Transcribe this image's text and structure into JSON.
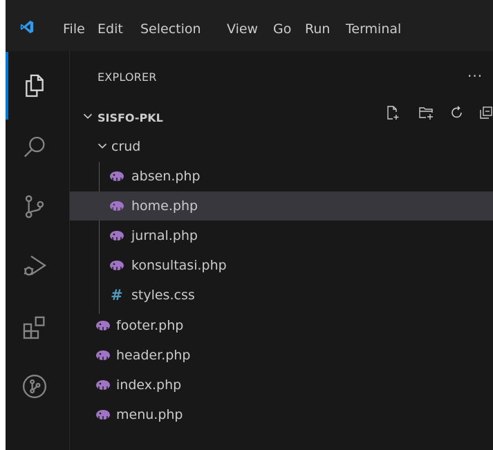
{
  "menu": {
    "items": [
      "File",
      "Edit",
      "Selection",
      "View",
      "Go",
      "Run",
      "Terminal"
    ]
  },
  "sidebar": {
    "title": "EXPLORER",
    "more": "···",
    "project": "SISFO-PKL",
    "folder": "crud",
    "folder_files": [
      "absen.php",
      "home.php",
      "jurnal.php",
      "konsultasi.php",
      "styles.css"
    ],
    "root_files": [
      "footer.php",
      "header.php",
      "index.php",
      "menu.php"
    ],
    "selected_file": "home.php"
  },
  "colors": {
    "accent": "#0078d4",
    "php_icon": "#a074c4",
    "css_icon": "#519aba",
    "selected_row": "#37373d"
  },
  "icons": {
    "activity_bar": [
      "files-icon",
      "search-icon",
      "source-control-icon",
      "run-debug-icon",
      "extensions-icon",
      "gitlens-icon"
    ],
    "explorer_toolbar": [
      "new-file-icon",
      "new-folder-icon",
      "refresh-icon",
      "collapse-all-icon"
    ]
  }
}
